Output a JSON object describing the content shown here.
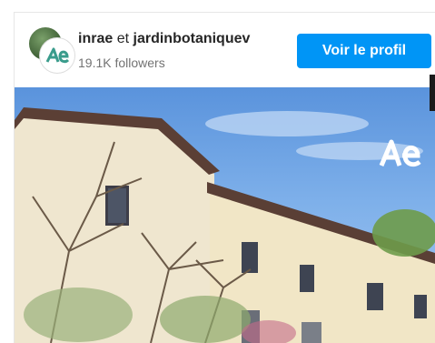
{
  "account": {
    "first_name": "inrae",
    "connector": "et",
    "second_name": "jardinbotaniquev",
    "followers": "19.1K followers",
    "avatar_back": "plant-photo-avatar",
    "avatar_front": "ae-logo-avatar"
  },
  "actions": {
    "view_profile": "Voir le profil"
  },
  "post": {
    "image": "building-with-trees-photo",
    "logo_icon": "ae-logo-icon"
  },
  "colors": {
    "button": "#0095f6",
    "logo_teal": "#3a9c8c",
    "text_primary": "#262626",
    "text_secondary": "#737373",
    "sky": "#6aa2e3"
  }
}
